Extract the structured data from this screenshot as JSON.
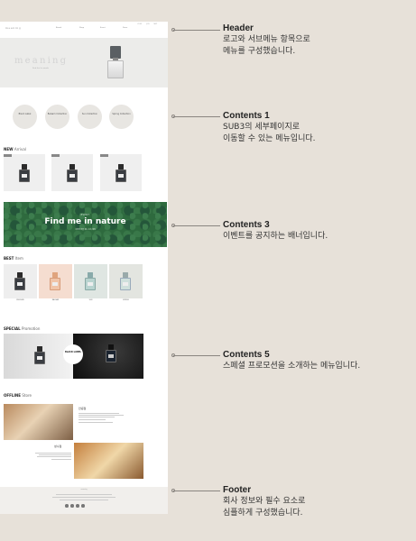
{
  "header": {
    "logo": "meaning",
    "nav": [
      "Brand",
      "Shop",
      "Event",
      "Store"
    ],
    "util": [
      "LOGIN",
      "JOIN",
      "CART"
    ]
  },
  "hero": {
    "title": "meaning",
    "subtitle": "Find the tin words"
  },
  "categories": [
    "Black Label",
    "Balsam Collection",
    "Sun Collection",
    "Spring Collection"
  ],
  "new_section": {
    "title": "NEW",
    "subtitle": "Arrival"
  },
  "banner": {
    "event": "EVENT",
    "title": "Find me in nature",
    "sub": "나만의 향을 찾는 숲속 체험"
  },
  "best_section": {
    "title": "BEST",
    "subtitle": "Item"
  },
  "best_labels": [
    "PERFUME",
    "BALSAM",
    "SUN",
    "SPRING"
  ],
  "special_section": {
    "title": "SPECIAL",
    "subtitle": "Promotion"
  },
  "promo": {
    "circle": "BLACK LABEL"
  },
  "offline_section": {
    "title": "OFFLINE",
    "subtitle": "Store"
  },
  "offline": {
    "store1": "안녕점",
    "store2": "성수점"
  },
  "footer": {
    "brand": "meaning"
  },
  "annotations": [
    {
      "title": "Header",
      "desc1": "로고와 서브메뉴 항목으로",
      "desc2": "메뉴를 구성했습니다."
    },
    {
      "title": "Contents 1",
      "desc1": "SUB3의 세부페이지로",
      "desc2": "이동할 수 있는 메뉴입니다."
    },
    {
      "title": "Contents 3",
      "desc1": "이벤트를 공지하는 배너입니다.",
      "desc2": ""
    },
    {
      "title": "Contents 5",
      "desc1": "스페셜 프로모션을 소개하는 메뉴입니다.",
      "desc2": ""
    },
    {
      "title": "Footer",
      "desc1": "회사 정보와 필수 요소로",
      "desc2": "심플하게 구성했습니다."
    }
  ]
}
